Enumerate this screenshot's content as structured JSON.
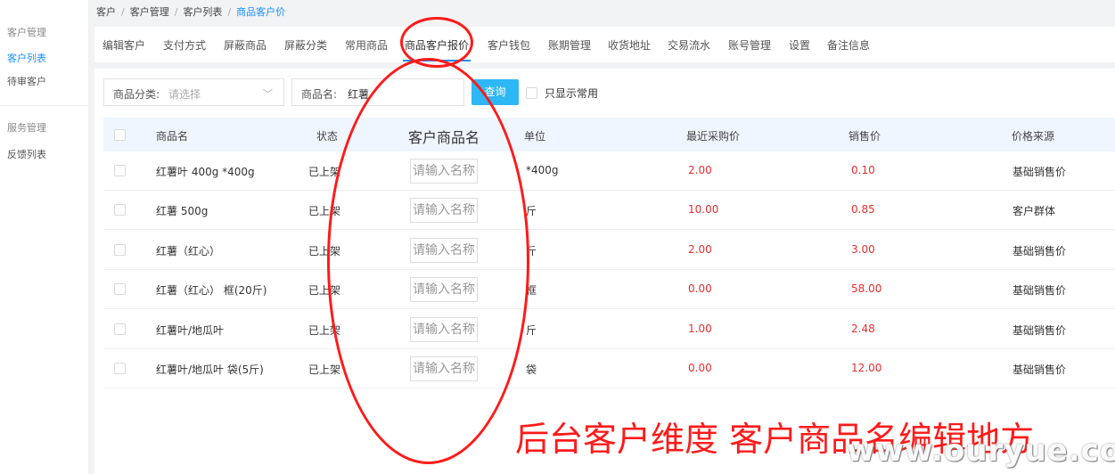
{
  "sidebar": {
    "items": [
      {
        "label": "客户管理",
        "type": "group"
      },
      {
        "label": "客户列表",
        "type": "active"
      },
      {
        "label": "待审客户",
        "type": "item"
      },
      {
        "label": "服务管理",
        "type": "group"
      },
      {
        "label": "反馈列表",
        "type": "item"
      }
    ]
  },
  "breadcrumb": {
    "items": [
      "客户",
      "客户管理",
      "客户列表",
      "商品客户价"
    ],
    "separator": "/"
  },
  "tabs": [
    "编辑客户",
    "支付方式",
    "屏蔽商品",
    "屏蔽分类",
    "常用商品",
    "商品客户报价",
    "客户钱包",
    "账期管理",
    "收货地址",
    "交易流水",
    "账号管理",
    "设置",
    "备注信息"
  ],
  "active_tab": "商品客户报价",
  "filters": {
    "category_label": "商品分类:",
    "category_placeholder": "请选择",
    "name_label": "商品名:",
    "name_value": "红薯",
    "query_button": "查询",
    "only_common_label": "只显示常用"
  },
  "table": {
    "headers": [
      "商品名",
      "状态",
      "客户商品名",
      "单位",
      "最近采购价",
      "销售价",
      "价格来源"
    ],
    "input_placeholder": "请输入名称",
    "rows": [
      {
        "name": "红薯叶 400g *400g",
        "status": "已上架",
        "unit": "*400g",
        "last_price": "2.00",
        "sale_price": "0.10",
        "source": "基础销售价"
      },
      {
        "name": "红薯 500g",
        "status": "已上架",
        "unit": "斤",
        "last_price": "10.00",
        "sale_price": "0.85",
        "source": "客户群体"
      },
      {
        "name": "红薯（红心）",
        "status": "已上架",
        "unit": "斤",
        "last_price": "2.00",
        "sale_price": "3.00",
        "source": "基础销售价"
      },
      {
        "name": "红薯（红心） 框(20斤)",
        "status": "已上架",
        "unit": "框",
        "last_price": "0.00",
        "sale_price": "58.00",
        "source": "基础销售价"
      },
      {
        "name": "红薯叶/地瓜叶",
        "status": "已上架",
        "unit": "斤",
        "last_price": "1.00",
        "sale_price": "2.48",
        "source": "基础销售价"
      },
      {
        "name": "红薯叶/地瓜叶 袋(5斤)",
        "status": "已上架",
        "unit": "袋",
        "last_price": "0.00",
        "sale_price": "12.00",
        "source": "基础销售价"
      }
    ]
  },
  "annotation": {
    "text": "后台客户维度 客户商品名编辑地方",
    "color": "#ff1a1a"
  },
  "watermark": "www.ouryue.com",
  "colors": {
    "accent": "#1890ff",
    "query_button": "#2db7f5",
    "price": "#e62e2e",
    "header_bg": "#f0f6ff"
  }
}
